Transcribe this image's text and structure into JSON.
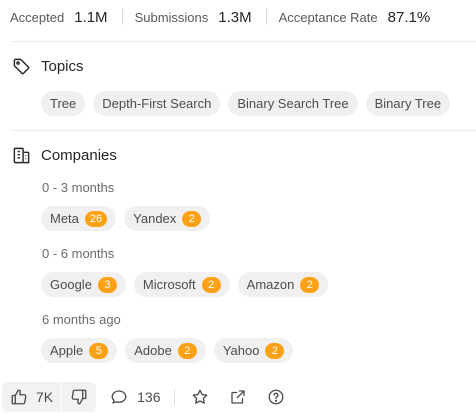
{
  "stats": [
    {
      "label": "Accepted",
      "value": "1.1M"
    },
    {
      "label": "Submissions",
      "value": "1.3M"
    },
    {
      "label": "Acceptance Rate",
      "value": "87.1%"
    }
  ],
  "topics": {
    "title": "Topics",
    "tags": [
      "Tree",
      "Depth-First Search",
      "Binary Search Tree",
      "Binary Tree"
    ]
  },
  "companies": {
    "title": "Companies",
    "groups": [
      {
        "period": "0 - 3 months",
        "items": [
          {
            "name": "Meta",
            "count": "26"
          },
          {
            "name": "Yandex",
            "count": "2"
          }
        ]
      },
      {
        "period": "0 - 6 months",
        "items": [
          {
            "name": "Google",
            "count": "3"
          },
          {
            "name": "Microsoft",
            "count": "2"
          },
          {
            "name": "Amazon",
            "count": "2"
          }
        ]
      },
      {
        "period": "6 months ago",
        "items": [
          {
            "name": "Apple",
            "count": "5"
          },
          {
            "name": "Adobe",
            "count": "2"
          },
          {
            "name": "Yahoo",
            "count": "2"
          }
        ]
      }
    ]
  },
  "footer": {
    "likes": "7K",
    "comments": "136",
    "icons": [
      "thumbs-up-icon",
      "thumbs-down-icon",
      "comment-icon",
      "star-icon",
      "share-icon",
      "help-icon"
    ]
  },
  "colors": {
    "accent": "#ffa116",
    "chip_bg": "#f0f0f0",
    "text": "#262626",
    "muted": "#595959"
  }
}
